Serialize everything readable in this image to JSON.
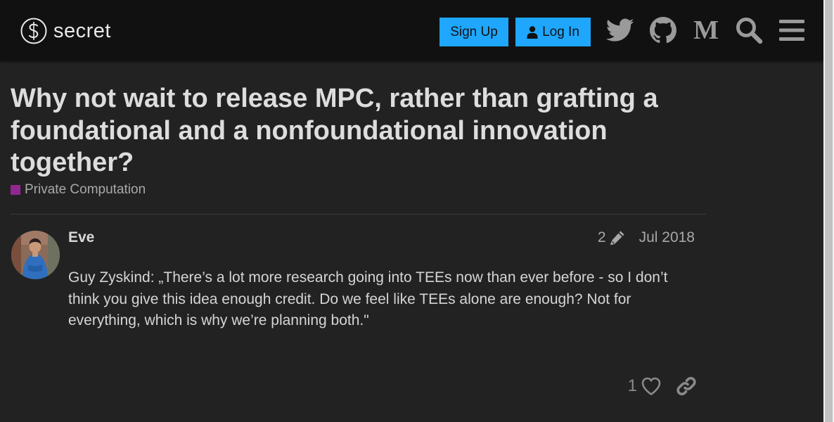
{
  "header": {
    "logo_text": "secret",
    "signup_label": "Sign Up",
    "login_label": "Log In",
    "icons": [
      "twitter-icon",
      "github-icon",
      "medium-icon",
      "search-icon",
      "menu-icon"
    ]
  },
  "topic": {
    "title": "Why not wait to release MPC, rather than grafting a foundational and a nonfoundational innovation together?",
    "category": "Private Computation",
    "category_color": "#92278f"
  },
  "post": {
    "username": "Eve",
    "edit_count": "2",
    "date": "Jul 2018",
    "body": "Guy Zyskind: „There’s a lot more research going into TEEs now than ever before - so I don’t think you give this idea enough credit. Do we feel like TEEs alone are enough? Not for everything, which is why we’re planning both.\"",
    "like_count": "1"
  },
  "colors": {
    "accent": "#1ea7fd",
    "header_bg": "#111111",
    "page_bg": "#222222"
  }
}
